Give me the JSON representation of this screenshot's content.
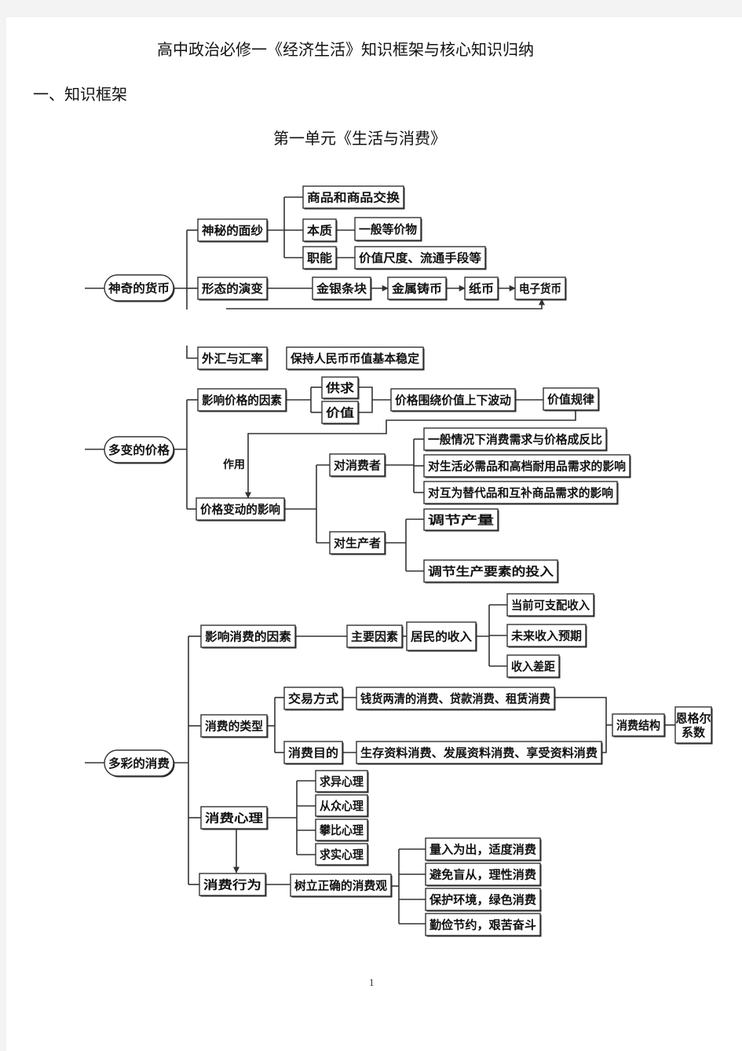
{
  "document": {
    "title": "高中政治必修一《经济生活》知识框架与核心知识归纳",
    "section_heading": "一、知识框架",
    "unit_title": "第一单元《生活与消费》",
    "page_number": "1"
  },
  "diagram": {
    "money": {
      "root": "神奇的货币",
      "veil": "神秘的面纱",
      "commodity_exchange": "商品和商品交换",
      "essence": "本质",
      "general_equivalent": "一般等价物",
      "functions": "职能",
      "functions_detail": "价值尺度、流通手段等",
      "evolution": "形态的演变",
      "forms": [
        "金银条块",
        "金属铸币",
        "纸币",
        "电子货币"
      ],
      "forex": "外汇与汇率",
      "forex_detail": "保持人民币币值基本稳定"
    },
    "price": {
      "root": "多变的价格",
      "factors": "影响价格的因素",
      "supply_demand": "供求",
      "value": "价值",
      "fluctuation": "价格围绕价值上下波动",
      "law_of_value": "价值规律",
      "effect_label": "作用",
      "impact": "价格变动的影响",
      "consumers": "对消费者",
      "consumer_items": [
        "一般情况下消费需求与价格成反比",
        "对生活必需品和高档耐用品需求的影响",
        "对互为替代品和互补商品需求的影响"
      ],
      "producers": "对生产者",
      "producer_items": [
        "调节产量",
        "调节生产要素的投入"
      ]
    },
    "consumption": {
      "root": "多彩的消费",
      "factors": "影响消费的因素",
      "main_factor": "主要因素",
      "income": "居民的收入",
      "income_items": [
        "当前可支配收入",
        "未来收入预期",
        "收入差距"
      ],
      "types": "消费的类型",
      "trade_method": "交易方式",
      "trade_detail": "钱货两清的消费、贷款消费、租赁消费",
      "purpose": "消费目的",
      "purpose_detail": "生存资料消费、发展资料消费、享受资料消费",
      "structure": "消费结构",
      "engel": "恩格尔系数",
      "psychology": "消费心理",
      "psychology_items": [
        "求异心理",
        "从众心理",
        "攀比心理",
        "求实心理"
      ],
      "behavior": "消费行为",
      "correct_view": "树立正确的消费观",
      "view_items": [
        "量入为出，适度消费",
        "避免盲从，理性消费",
        "保护环境，绿色消费",
        "勤俭节约，艰苦奋斗"
      ]
    }
  }
}
